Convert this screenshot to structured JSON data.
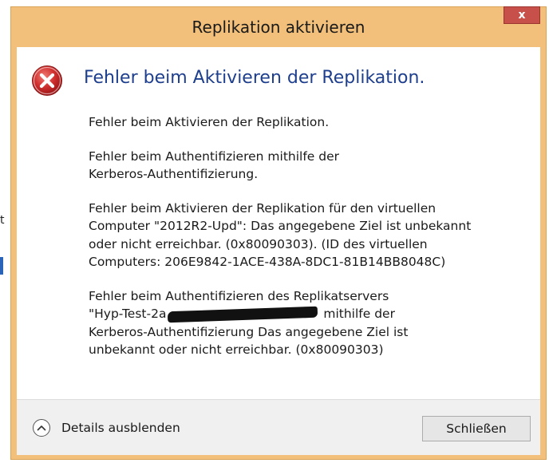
{
  "window": {
    "title": "Replikation aktivieren",
    "close_symbol": "x"
  },
  "background": {
    "edge_letter": "t"
  },
  "dialog": {
    "icon": "error-icon",
    "heading": "Fehler beim Aktivieren der Replikation.",
    "messages": [
      {
        "lines": [
          "Fehler beim Aktivieren der Replikation."
        ]
      },
      {
        "lines": [
          "Fehler beim Authentifizieren mithilfe der",
          "Kerberos-Authentifizierung."
        ]
      },
      {
        "lines": [
          "Fehler beim Aktivieren der Replikation für den virtuellen",
          "Computer \"2012R2-Upd\": Das angegebene Ziel ist unbekannt",
          "oder nicht erreichbar. (0x80090303). (ID des virtuellen",
          "Computers: 206E9842-1ACE-438A-8DC1-81B14BB8048C)"
        ]
      },
      {
        "line1": "Fehler beim Authentifizieren des Replikatservers",
        "line2_prefix": "\"Hyp-Test-2a",
        "line2_suffix": " mithilfe der",
        "line3": "Kerberos-Authentifizierung Das angegebene Ziel ist",
        "line4": "unbekannt oder nicht erreichbar. (0x80090303)"
      }
    ]
  },
  "footer": {
    "details_label": "Details ausblenden",
    "close_label": "Schließen"
  },
  "colors": {
    "title_bar": "#f2c07a",
    "close_button": "#c7504a",
    "heading": "#1e3f8e",
    "error_red": "#c8252b"
  }
}
